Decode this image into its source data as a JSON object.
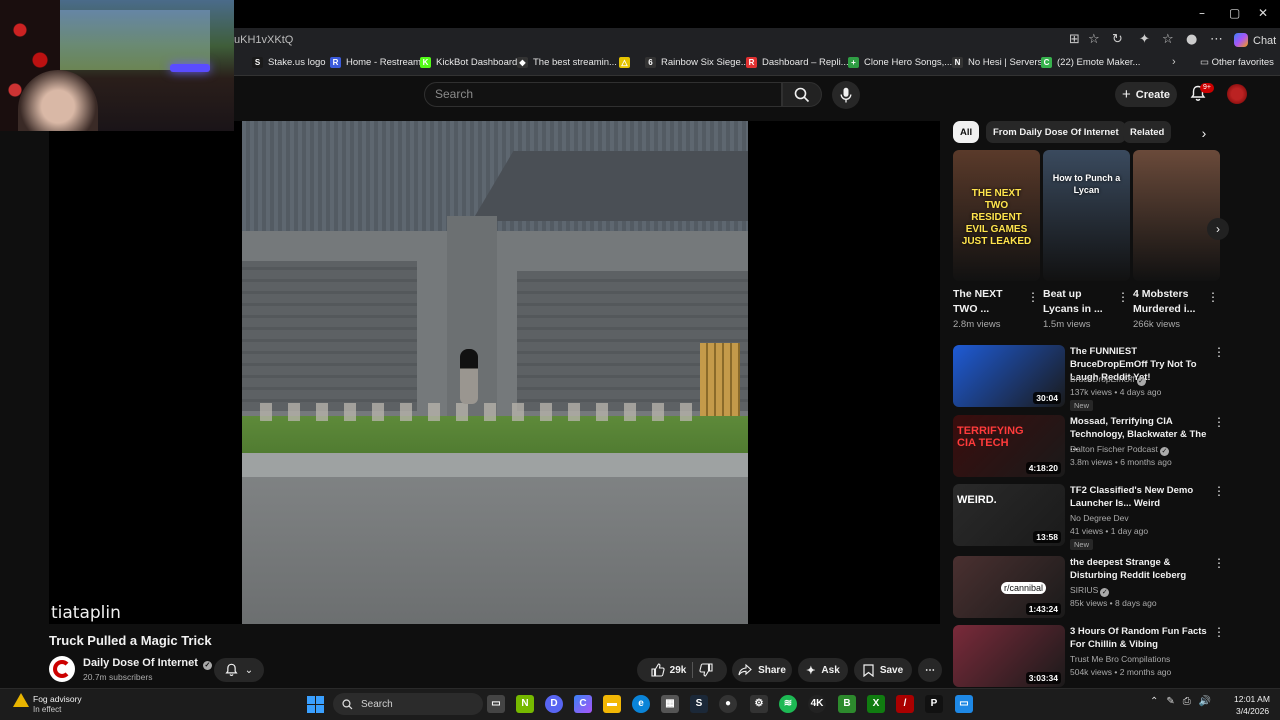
{
  "browser": {
    "url_fragment": "uKH1vXKtQ",
    "chat_label": "Chat"
  },
  "bookmarks": {
    "items": [
      {
        "label": "Stake.us logo",
        "color": "#1a1a1a",
        "glyph": "S"
      },
      {
        "label": "Home - Restream",
        "color": "#3b5bdb",
        "glyph": "R"
      },
      {
        "label": "KickBot Dashboard",
        "color": "#53fc18",
        "glyph": "K"
      },
      {
        "label": "The best streamin...",
        "color": "#333333",
        "glyph": "◆"
      },
      {
        "label": "",
        "color": "#e6c400",
        "glyph": "△"
      },
      {
        "label": "Rainbow Six Siege...",
        "color": "#333333",
        "glyph": "6"
      },
      {
        "label": "Dashboard – Repli...",
        "color": "#e03131",
        "glyph": "R"
      },
      {
        "label": "Clone Hero Songs,...",
        "color": "#2f9e44",
        "glyph": "+"
      },
      {
        "label": "No Hesi | Servers",
        "color": "#333333",
        "glyph": "N"
      },
      {
        "label": "(22) Emote Maker...",
        "color": "#37b24d",
        "glyph": "C"
      }
    ],
    "other": "Other favorites"
  },
  "header": {
    "search_placeholder": "Search",
    "create_label": "Create",
    "notifications": "9+"
  },
  "video": {
    "watermark": "tiataplin",
    "title": "Truck Pulled a Magic Trick",
    "channel": "Daily Dose Of Internet",
    "subscribers": "20.7m subscribers",
    "likes": "29k",
    "share": "Share",
    "ask": "Ask",
    "save": "Save"
  },
  "chips": [
    "All",
    "From Daily Dose Of Internet",
    "Related"
  ],
  "shorts": [
    {
      "title": "The NEXT TWO ...",
      "views": "2.8m views",
      "thumb_text": "THE NEXT TWO RESIDENT EVIL GAMES JUST LEAKED",
      "bg": "#5a3a2a"
    },
    {
      "title": "Beat up Lycans in ...",
      "views": "1.5m views",
      "thumb_text": "How to Punch a Lycan",
      "bg": "#3a4a5e"
    },
    {
      "title": "4 Mobsters Murdered i...",
      "views": "266k views",
      "thumb_text": "",
      "bg": "#6a4a3a"
    }
  ],
  "recommendations": [
    {
      "title": "The FUNNIEST BruceDropEmOff Try Not To Laugh Reddit Yet!",
      "channel": "BruceDropEmOff",
      "meta": "137k views • 4 days ago",
      "badge": "New",
      "duration": "30:04",
      "bg": "#1e5bd6",
      "thumb_text": ""
    },
    {
      "title": "Mossad, Terrifying CIA Technology, Blackwater & The ...",
      "channel": "Dalton Fischer Podcast",
      "meta": "3.8m views • 6 months ago",
      "badge": "",
      "duration": "4:18:20",
      "bg": "#3a0d0d",
      "thumb_text": "TERRIFYING CIA TECH"
    },
    {
      "title": "TF2 Classified's New Demo Launcher Is... Weird",
      "channel": "No Degree Dev",
      "meta": "41 views • 1 day ago",
      "badge": "New",
      "duration": "13:58",
      "bg": "#2a2a2a",
      "thumb_text": "WEIRD."
    },
    {
      "title": "the deepest Strange & Disturbing Reddit Iceberg",
      "channel": "SIRIUS",
      "meta": "85k views • 8 days ago",
      "badge": "",
      "duration": "1:43:24",
      "bg": "#4a3030",
      "thumb_text": "r/cannibal"
    },
    {
      "title": "3 Hours Of Random Fun Facts For Chillin & Vibing",
      "channel": "Trust Me Bro Compilations",
      "meta": "504k views • 2 months ago",
      "badge": "",
      "duration": "3:03:34",
      "bg": "#7a2a3a",
      "thumb_text": ""
    }
  ],
  "taskbar": {
    "weather_title": "Fog advisory",
    "weather_sub": "In effect",
    "search": "Search",
    "time": "12:01 AM",
    "date": "3/4/2026"
  }
}
